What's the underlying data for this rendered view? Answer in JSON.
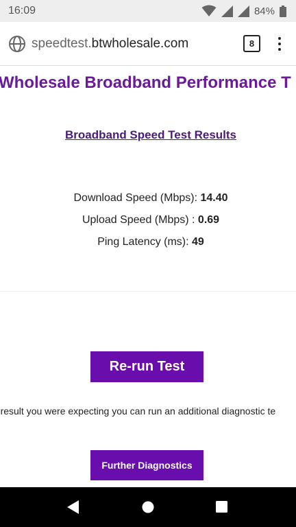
{
  "status_bar": {
    "time": "16:09",
    "battery_percent": "84%",
    "icons": [
      "wifi-icon",
      "signal-icon",
      "signal-icon",
      "battery-icon"
    ]
  },
  "browser": {
    "url_prefix": "speedtest.",
    "url_domain": "btwholesale.com",
    "tab_count": "8",
    "icons": [
      "globe-icon",
      "menu-icon"
    ]
  },
  "page": {
    "heading": "Wholesale Broadband Performance T",
    "results_title": "Broadband Speed Test Results",
    "metrics": {
      "download_label": "Download Speed (Mbps): ",
      "download_value": "14.40",
      "upload_label": "Upload Speed (Mbps) : ",
      "upload_value": "0.69",
      "ping_label": "Ping Latency (ms): ",
      "ping_value": "49"
    },
    "rerun_button": "Re-run Test",
    "diagnostic_text": "est result you were expecting you can run an additional diagnostic te",
    "further_button": "Further Diagnostics"
  },
  "nav_bar": {
    "icons": [
      "back-icon",
      "home-icon",
      "recents-icon"
    ]
  },
  "colors": {
    "brand_purple": "#6a0dad",
    "heading_purple": "#6b1a9a"
  }
}
